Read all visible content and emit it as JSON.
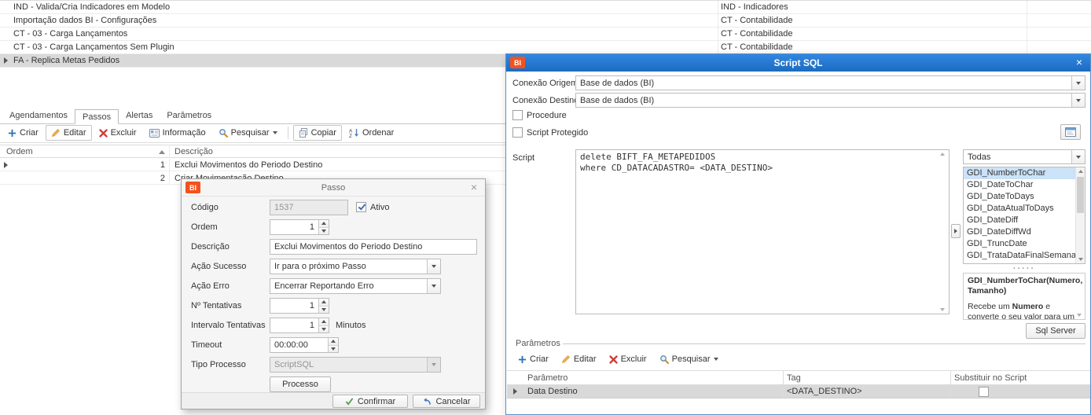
{
  "top_table": {
    "rows": [
      {
        "name": "IND - Valida/Cria Indicadores em Modelo",
        "group": "IND - Indicadores"
      },
      {
        "name": "Importação dados BI - Configurações",
        "group": "CT - Contabilidade"
      },
      {
        "name": "CT - 03 - Carga Lançamentos",
        "group": "CT - Contabilidade"
      },
      {
        "name": "CT - 03 - Carga Lançamentos Sem Plugin",
        "group": "CT - Contabilidade"
      },
      {
        "name": "FA - Replica Metas Pedidos",
        "group": ""
      }
    ]
  },
  "tabs": {
    "agendamentos": "Agendamentos",
    "passos": "Passos",
    "alertas": "Alertas",
    "parametros": "Parâmetros"
  },
  "steps": {
    "toolbar": {
      "criar": "Criar",
      "editar": "Editar",
      "excluir": "Excluir",
      "informacao": "Informação",
      "pesquisar": "Pesquisar",
      "copiar": "Copiar",
      "ordenar": "Ordenar"
    },
    "columns": {
      "ordem": "Ordem",
      "descricao": "Descrição"
    },
    "rows": [
      {
        "ordem": "1",
        "descricao": "Exclui Movimentos do Periodo Destino"
      },
      {
        "ordem": "2",
        "descricao": "Criar Movimentação Destino"
      }
    ]
  },
  "passo_dialog": {
    "app_badge": "BI",
    "title": "Passo",
    "close": "×",
    "codigo_label": "Código",
    "codigo_value": "1537",
    "ativo_label": "Ativo",
    "ordem_label": "Ordem",
    "ordem_value": "1",
    "descricao_label": "Descrição",
    "descricao_value": "Exclui Movimentos do Periodo Destino",
    "acao_sucesso_label": "Ação Sucesso",
    "acao_sucesso_value": "Ir para o próximo Passo",
    "acao_erro_label": "Ação Erro",
    "acao_erro_value": "Encerrar Reportando Erro",
    "tentativas_label": "Nº Tentativas",
    "tentativas_value": "1",
    "intervalo_label": "Intervalo Tentativas",
    "intervalo_value": "1",
    "intervalo_sufixo": "Minutos",
    "timeout_label": "Timeout",
    "timeout_value": "00:00:00",
    "tipo_processo_label": "Tipo Processo",
    "tipo_processo_value": "ScriptSQL",
    "processo_button": "Processo",
    "confirmar_button": "Confirmar",
    "cancelar_button": "Cancelar"
  },
  "script_dialog": {
    "app_badge": "BI",
    "title": "Script SQL",
    "close": "×",
    "conexao_origem_label": "Conexão Origem",
    "conexao_origem_value": "Base de dados (BI)",
    "conexao_destino_label": "Conexão Destino",
    "conexao_destino_value": "Base de dados (BI)",
    "procedure_label": "Procedure",
    "script_protegido_label": "Script Protegido",
    "script_label": "Script",
    "script_text": "delete BIFT_FA_METAPEDIDOS\nwhere CD_DATACADASTRO= <DATA_DESTINO>",
    "functions_filter_value": "Todas",
    "functions": [
      "GDI_NumberToChar",
      "GDI_DateToChar",
      "GDI_DateToDays",
      "GDI_DataAtualToDays",
      "GDI_DateDiff",
      "GDI_DateDiffWd",
      "GDI_TruncDate",
      "GDI_TrataDataFinalSemana"
    ],
    "splitter_dots": "·····",
    "help_title": "GDI_NumberToChar(Numero, Tamanho)",
    "help_pre": "Recebe um ",
    "help_bold": "Numero",
    "help_post": " e converte o seu valor para um",
    "sql_server_button": "Sql Server",
    "parametros": {
      "group_label": "Parâmetros",
      "toolbar": {
        "criar": "Criar",
        "editar": "Editar",
        "excluir": "Excluir",
        "pesquisar": "Pesquisar"
      },
      "columns": {
        "parametro": "Parâmetro",
        "tag": "Tag",
        "substituir": "Substituir no Script"
      },
      "rows": [
        {
          "parametro": "Data Destino",
          "tag": "<DATA_DESTINO>"
        }
      ]
    }
  }
}
